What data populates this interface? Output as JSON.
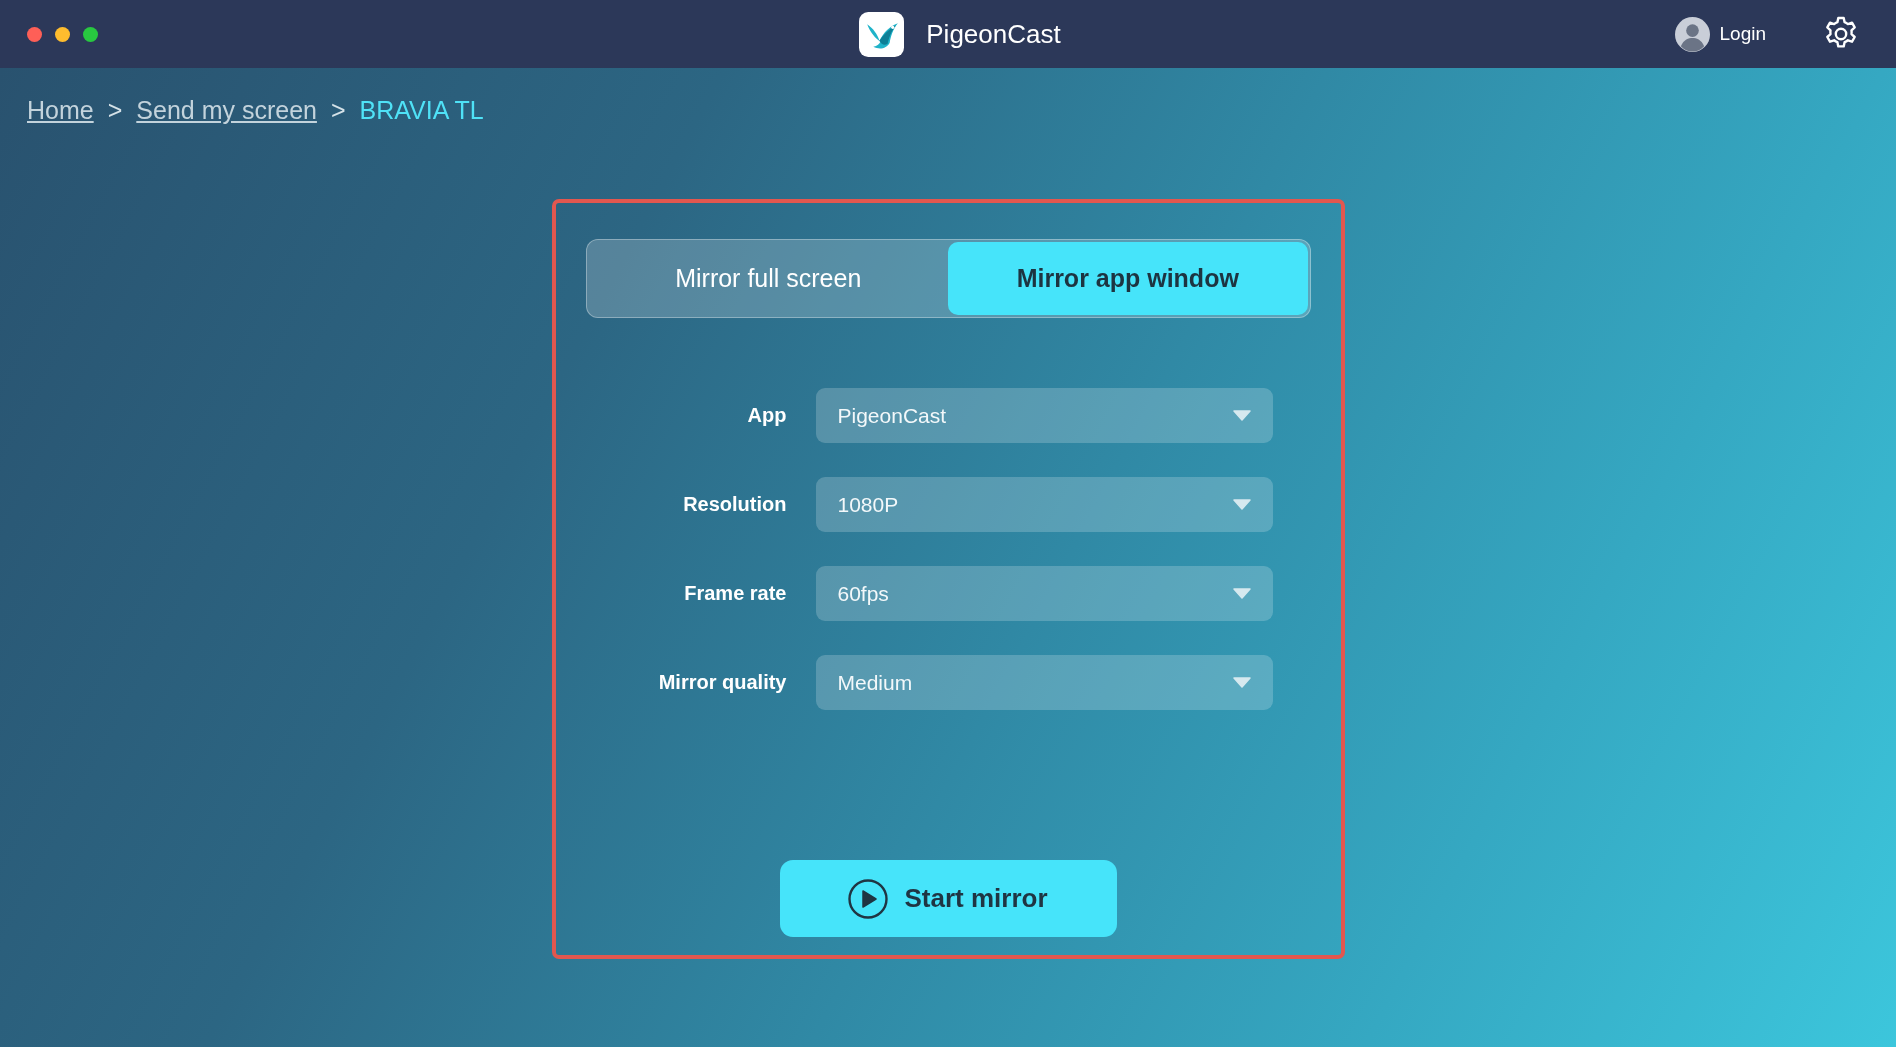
{
  "window": {
    "title": "PigeonCast"
  },
  "header": {
    "login_label": "Login"
  },
  "breadcrumb": [
    {
      "label": "Home",
      "kind": "link"
    },
    {
      "label": ">",
      "kind": "separator"
    },
    {
      "label": "Send my screen",
      "kind": "link"
    },
    {
      "label": ">",
      "kind": "separator"
    },
    {
      "label": "BRAVIA TL",
      "kind": "current"
    }
  ],
  "tabs": [
    {
      "label": "Mirror full screen",
      "selected": false
    },
    {
      "label": "Mirror app window",
      "selected": true
    }
  ],
  "settings": [
    {
      "label": "App",
      "value": "PigeonCast"
    },
    {
      "label": "Resolution",
      "value": "1080P"
    },
    {
      "label": "Frame rate",
      "value": "60fps"
    },
    {
      "label": "Mirror quality",
      "value": "Medium"
    }
  ],
  "primary_button": {
    "label": "Start mirror"
  }
}
